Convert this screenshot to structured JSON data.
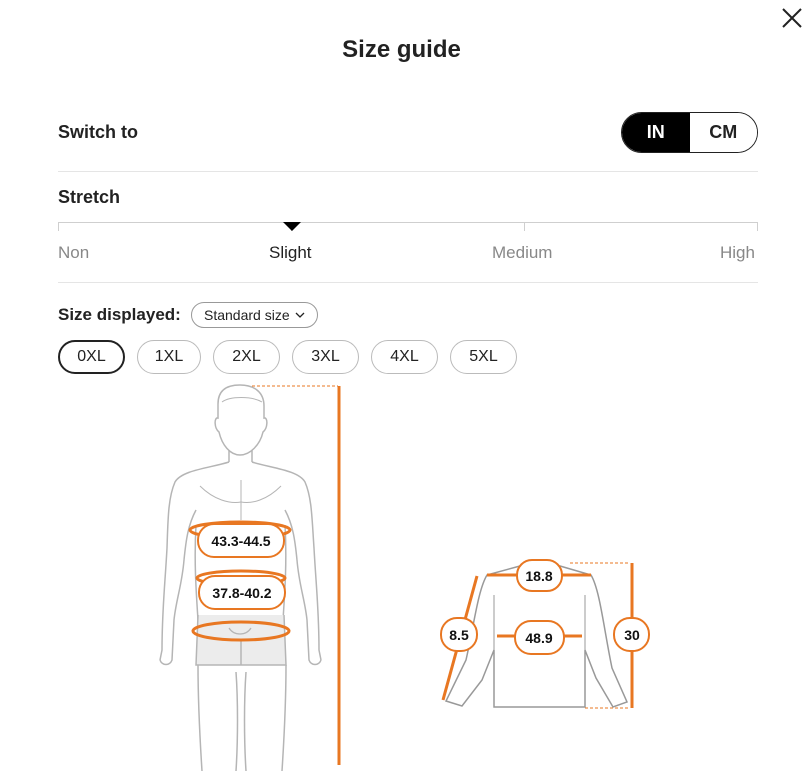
{
  "modal": {
    "title": "Size guide",
    "close_icon": "close-icon"
  },
  "unit_switch": {
    "label": "Switch to",
    "options": [
      "IN",
      "CM"
    ],
    "selected": "IN"
  },
  "stretch": {
    "label": "Stretch",
    "levels": [
      "Non",
      "Slight",
      "Medium",
      "High"
    ],
    "selected": "Slight"
  },
  "size_display": {
    "label": "Size displayed:",
    "select_value": "Standard size",
    "select_icon": "chevron-down-icon"
  },
  "sizes": {
    "options": [
      "0XL",
      "1XL",
      "2XL",
      "3XL",
      "4XL",
      "5XL"
    ],
    "selected": "0XL"
  },
  "body_measurements": {
    "chest": "43.3-44.5",
    "waist": "37.8-40.2"
  },
  "garment_measurements": {
    "shoulder": "18.8",
    "sleeve": "8.5",
    "chest": "48.9",
    "length": "30"
  },
  "colors": {
    "accent": "#E87722",
    "outline": "#b5b5b5",
    "active": "#000000"
  }
}
